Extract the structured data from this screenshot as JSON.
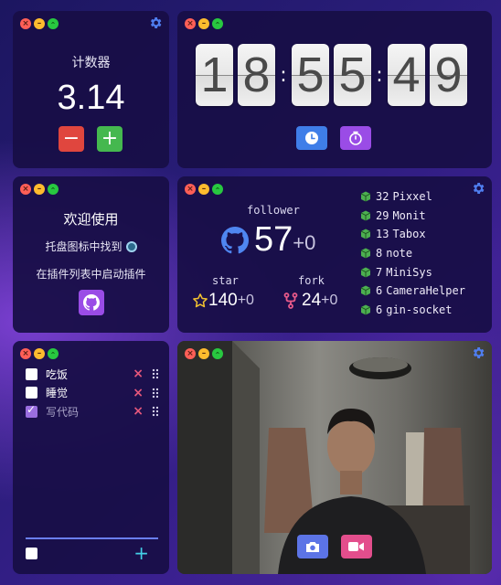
{
  "counter": {
    "title": "计数器",
    "value": "3.14",
    "minus_label": "−",
    "plus_label": "+"
  },
  "clock": {
    "digits": [
      "1",
      "8",
      "5",
      "5",
      "4",
      "9"
    ],
    "separator": ":"
  },
  "welcome": {
    "title": "欢迎使用",
    "line1": "托盘图标中找到",
    "line2": "在插件列表中启动插件"
  },
  "github": {
    "follower_label": "follower",
    "follower_count": "57",
    "follower_delta": "+0",
    "star_label": "star",
    "star_count": "140",
    "star_delta": "+0",
    "fork_label": "fork",
    "fork_count": "24",
    "fork_delta": "+0",
    "repos": [
      {
        "stars": "32",
        "name": "Pixxel"
      },
      {
        "stars": "29",
        "name": "Monit"
      },
      {
        "stars": "13",
        "name": "Tabox"
      },
      {
        "stars": "8",
        "name": "note"
      },
      {
        "stars": "7",
        "name": "MiniSys"
      },
      {
        "stars": "6",
        "name": "CameraHelper"
      },
      {
        "stars": "6",
        "name": "gin-socket"
      }
    ]
  },
  "todo": {
    "items": [
      {
        "text": "吃饭",
        "done": false
      },
      {
        "text": "睡觉",
        "done": false
      },
      {
        "text": "写代码",
        "done": true
      }
    ],
    "delete_label": "×",
    "add_label": "+"
  },
  "colors": {
    "accent_blue": "#3f7ee8",
    "accent_purple": "#9a4ce6",
    "minus_red": "#e0463e",
    "plus_green": "#45b84f",
    "repo_icon_green": "#4caf50"
  },
  "icons": {
    "settings": "gear-icon",
    "clock": "clock-icon",
    "timer": "stopwatch-icon",
    "github": "github-icon",
    "star": "star-icon",
    "fork": "fork-icon",
    "repo": "cube-icon",
    "camera": "camera-icon",
    "video": "video-camera-icon"
  }
}
